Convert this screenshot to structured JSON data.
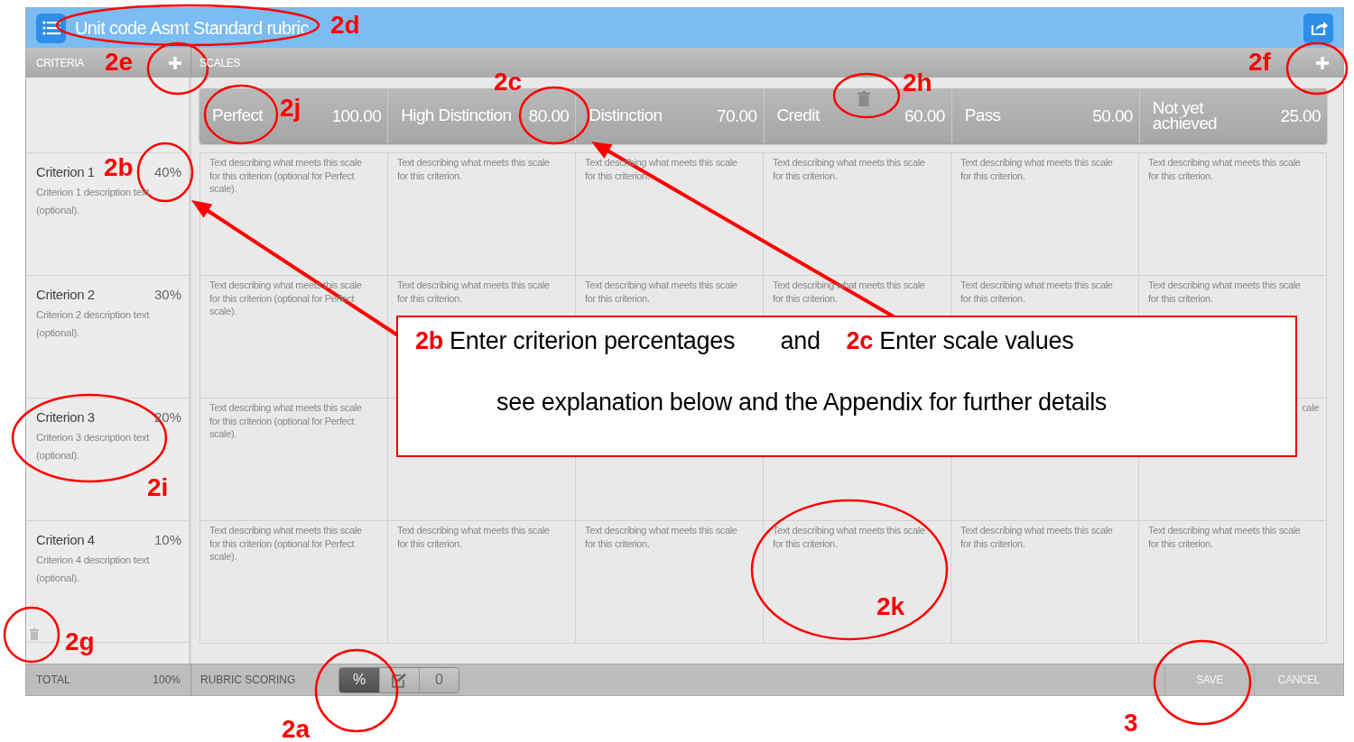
{
  "app": {
    "title": "Unit code Asmt Standard rubric"
  },
  "criteria_header": {
    "label": "CRITERIA"
  },
  "scales_header": {
    "label": "SCALES"
  },
  "scales": [
    {
      "name": "Perfect",
      "value": "100.00"
    },
    {
      "name": "High Distinction",
      "value": "80.00"
    },
    {
      "name": "Distinction",
      "value": "70.00"
    },
    {
      "name": "Credit",
      "value": "60.00"
    },
    {
      "name": "Pass",
      "value": "50.00"
    },
    {
      "name": "Not yet achieved",
      "value": "25.00"
    }
  ],
  "criteria": [
    {
      "name": "Criterion 1",
      "percent": "40%",
      "description": "Criterion 1 description text (optional).",
      "cells": [
        {
          "text": "Text describing what meets this scale for this criterion (optional for Perfect scale)."
        },
        {
          "text": "Text describing what meets this scale for this criterion."
        },
        {
          "text": "Text describing what meets this scale for this criterion."
        },
        {
          "text": "Text describing what meets this scale for this criterion."
        },
        {
          "text": "Text describing what meets this scale for this criterion."
        },
        {
          "text": "Text describing what meets this scale for this criterion."
        }
      ]
    },
    {
      "name": "Criterion 2",
      "percent": "30%",
      "description": "Criterion 2 description text (optional).",
      "cells": [
        {
          "text": "Text describing what meets this scale for this criterion (optional for Perfect scale)."
        },
        {
          "text": "Text describing what meets this scale for this criterion."
        },
        {
          "text": "Text describing what meets this scale for this criterion."
        },
        {
          "text": "Text describing what meets this scale for this criterion."
        },
        {
          "text": "Text describing what meets this scale for this criterion."
        },
        {
          "text": "Text describing what meets this scale for this criterion."
        }
      ]
    },
    {
      "name": "Criterion 3",
      "percent": "20%",
      "description": "Criterion 3 description text (optional).",
      "cells": [
        {
          "text": "Text describing what meets this scale for this criterion (optional for Perfect scale)."
        },
        {},
        {},
        {},
        {},
        {
          "text": "cale",
          "kind": "fragment"
        }
      ]
    },
    {
      "name": "Criterion 4",
      "percent": "10%",
      "description": "Criterion 4 description text (optional).",
      "cells": [
        {
          "text": "Text describing what meets this scale for this criterion (optional for Perfect scale)."
        },
        {
          "text": "Text describing what meets this scale for this criterion."
        },
        {
          "text": "Text describing what meets this scale for this criterion."
        },
        {
          "text": "Text describing what meets this scale for this criterion."
        },
        {
          "text": "Text describing what meets this scale for this criterion."
        },
        {
          "text": "Text describing what meets this scale for this criterion."
        }
      ]
    }
  ],
  "footer": {
    "total_label": "TOTAL",
    "total": "100%",
    "scoring_label": "RUBRIC SCORING",
    "scoring_modes": [
      {
        "kind": "text",
        "label": "%",
        "selected": true
      },
      {
        "kind": "icon",
        "selected": false
      },
      {
        "kind": "text",
        "label": "0",
        "selected": false
      }
    ],
    "buttons": [
      {
        "label": "SAVE"
      },
      {
        "label": "CANCEL"
      }
    ]
  },
  "annotations": {
    "labels": [
      {
        "text": "2d"
      },
      {
        "text": "2e"
      },
      {
        "text": "2j"
      },
      {
        "text": "2c"
      },
      {
        "text": "2h"
      },
      {
        "text": "2f"
      },
      {
        "text": "2b"
      },
      {
        "text": "2i"
      },
      {
        "text": "2g"
      },
      {
        "text": "2k"
      },
      {
        "text": "2a"
      },
      {
        "text": "3"
      }
    ],
    "callout": {
      "line_1": "**2b** Enter criterion percentages       and    **2c** Enter scale values",
      "line_2": "see explanation below and the Appendix for further details"
    }
  }
}
